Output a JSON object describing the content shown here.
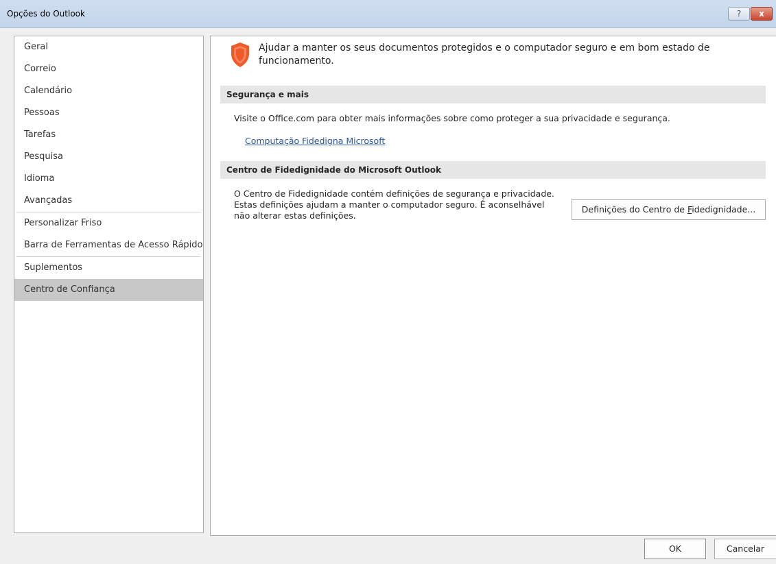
{
  "window": {
    "title": "Opções do Outlook",
    "help_glyph": "?",
    "close_glyph": "x"
  },
  "sidebar": {
    "items": [
      {
        "label": "Geral"
      },
      {
        "label": "Correio"
      },
      {
        "label": "Calendário"
      },
      {
        "label": "Pessoas"
      },
      {
        "label": "Tarefas"
      },
      {
        "label": "Pesquisa"
      },
      {
        "label": "Idioma"
      },
      {
        "label": "Avançadas"
      },
      {
        "label": "Personalizar Friso"
      },
      {
        "label": "Barra de Ferramentas de Acesso Rápido"
      },
      {
        "label": "Suplementos"
      },
      {
        "label": "Centro de Confiança",
        "selected": true
      }
    ]
  },
  "main": {
    "intro_icon": "shield-icon",
    "intro_text": "Ajudar a manter os seus documentos protegidos e o computador seguro e em bom estado de funcionamento.",
    "section1": {
      "header": "Segurança e mais",
      "description": "Visite o Office.com para obter mais informações sobre como proteger a sua privacidade e segurança.",
      "link": "Computação Fidedigna Microsoft"
    },
    "section2": {
      "header": "Centro de Fidedignidade do Microsoft Outlook",
      "description": "O Centro de Fidedignidade contém definições de segurança e privacidade. Estas definições ajudam a manter o computador seguro. É aconselhável não alterar estas definições.",
      "button_prefix": "Definições do Centro de ",
      "button_accel": "F",
      "button_suffix": "idedignidade..."
    }
  },
  "footer": {
    "ok_label": "OK",
    "cancel_label": "Cancelar"
  },
  "colors": {
    "title_bar": "#c9dbee",
    "selected_item": "#c8c8c8",
    "section_header": "#e6e6e6",
    "link": "#2b579a",
    "shield": "#f05a28"
  }
}
